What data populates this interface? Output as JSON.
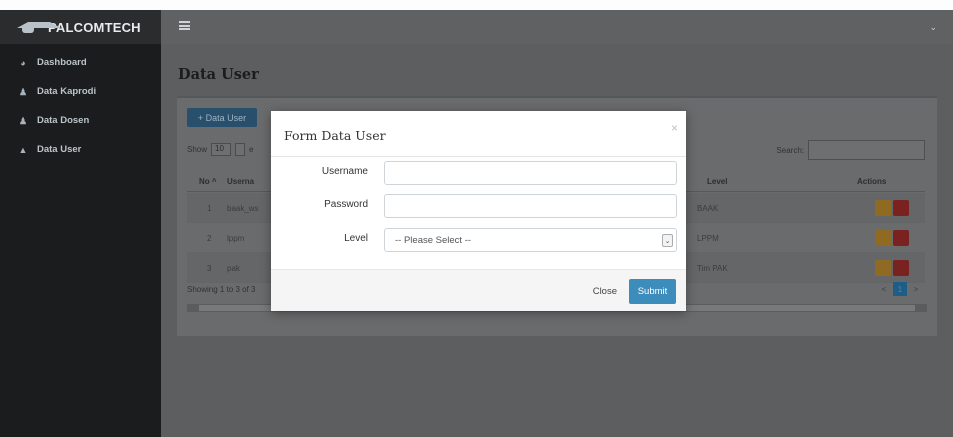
{
  "app": {
    "brand": "PALCOMTECH"
  },
  "sidebar": {
    "items": [
      {
        "label": "Dashboard",
        "icon": "dashboard-icon"
      },
      {
        "label": "Data Kaprodi",
        "icon": "users-icon"
      },
      {
        "label": "Data Dosen",
        "icon": "users-icon"
      },
      {
        "label": "Data User",
        "icon": "user-icon"
      }
    ]
  },
  "page": {
    "title": "Data User"
  },
  "toolbar": {
    "add_label": "+ Data User"
  },
  "table_controls": {
    "show_label": "Show",
    "show_value": "10",
    "show_suffix": "e",
    "search_label": "Search:"
  },
  "table": {
    "headers": {
      "no": "No ^",
      "username": "Userna",
      "level": "Level",
      "actions": "Actions"
    },
    "rows": [
      {
        "no": "1",
        "username": "baak_ws",
        "level": "BAAK"
      },
      {
        "no": "2",
        "username": "lppm",
        "level": "LPPM"
      },
      {
        "no": "3",
        "username": "pak",
        "level": "Tim PAK"
      }
    ],
    "info": "Showing 1 to 3 of 3",
    "pagination": {
      "prev": "<",
      "current": "1",
      "next": ">"
    }
  },
  "modal": {
    "title": "Form Data User",
    "close_icon": "×",
    "fields": {
      "username_label": "Username",
      "username_value": "",
      "password_label": "Password",
      "password_value": "",
      "level_label": "Level",
      "level_value": "-- Please Select --"
    },
    "close_label": "Close",
    "submit_label": "Submit"
  },
  "colors": {
    "primary": "#3c8dbc",
    "sidebar_bg": "#1a1c1e",
    "edit": "#f39c12",
    "delete": "#dd4b39"
  }
}
